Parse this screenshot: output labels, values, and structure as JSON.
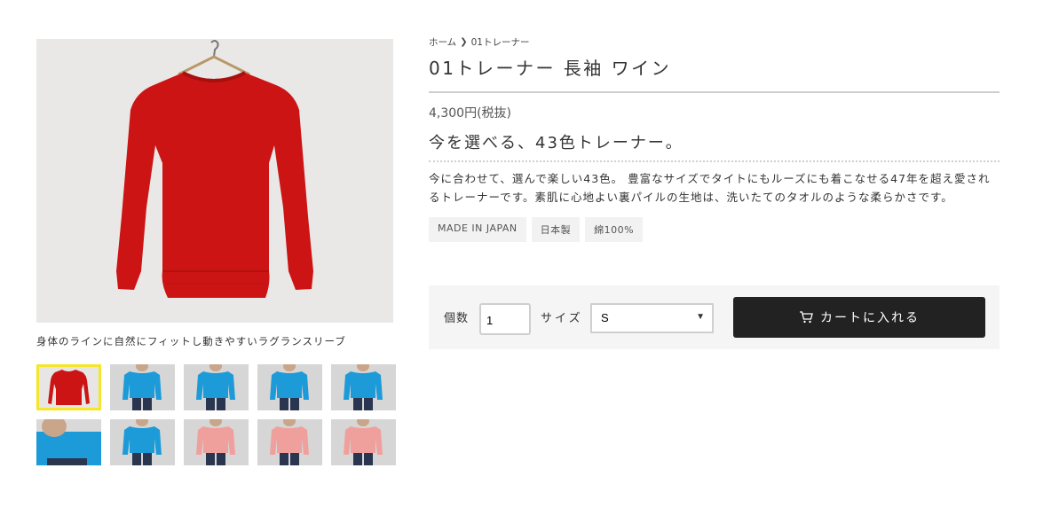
{
  "breadcrumb": {
    "home": "ホーム",
    "current": "01トレーナー"
  },
  "product": {
    "title": "01トレーナー 長袖 ワイン",
    "price": "4,300円(税抜)",
    "catch": "今を選べる、43色トレーナー。",
    "description": "今に合わせて、選んで楽しい43色。 豊富なサイズでタイトにもルーズにも着こなせる47年を超え愛されるトレーナーです。素肌に心地よい裏パイルの生地は、洗いたてのタオルのような柔らかさです。",
    "tags": [
      "MADE IN JAPAN",
      "日本製",
      "綿100%"
    ]
  },
  "gallery": {
    "caption": "身体のラインに自然にフィットし動きやすいラグランスリーブ",
    "thumbnails": [
      {
        "color": "#cc1414",
        "kind": "flat"
      },
      {
        "color": "#1d9bd8",
        "kind": "model"
      },
      {
        "color": "#1d9bd8",
        "kind": "model"
      },
      {
        "color": "#1d9bd8",
        "kind": "model"
      },
      {
        "color": "#1d9bd8",
        "kind": "model"
      },
      {
        "color": "#1d9bd8",
        "kind": "closeup"
      },
      {
        "color": "#1d9bd8",
        "kind": "model"
      },
      {
        "color": "#f0a09c",
        "kind": "model"
      },
      {
        "color": "#f0a09c",
        "kind": "model"
      },
      {
        "color": "#f0a09c",
        "kind": "model"
      }
    ]
  },
  "purchase": {
    "qty_label": "個数",
    "qty_value": "1",
    "size_label": "サイズ",
    "size_value": "S",
    "cart_label": "カートに入れる"
  },
  "colors": {
    "sweater_red": "#cc1414",
    "button_dark": "#222222",
    "active_thumb_border": "#f5e62a"
  }
}
